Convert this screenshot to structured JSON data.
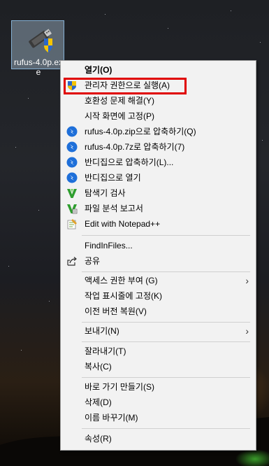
{
  "desktop": {
    "file_icon_label": "rufus-4.0p.ex\ne",
    "icon": "usb-drive-with-uac-shield-icon"
  },
  "context_menu": {
    "items": [
      {
        "label": "열기(O)",
        "bold": true,
        "icon": ""
      },
      {
        "label": "관리자 권한으로 실행(A)",
        "icon": "uac-shield-icon"
      },
      {
        "label": "호환성 문제 해결(Y)",
        "icon": ""
      },
      {
        "label": "시작 화면에 고정(P)",
        "icon": ""
      },
      {
        "label": "rufus-4.0p.zip으로 압축하기(Q)",
        "icon": "bandizip-icon"
      },
      {
        "label": "rufus-4.0p.7z로 압축하기(7)",
        "icon": "bandizip-icon"
      },
      {
        "label": "반디집으로 압축하기(L)...",
        "icon": "bandizip-icon"
      },
      {
        "label": "반디집으로 열기",
        "icon": "bandizip-icon"
      },
      {
        "label": "탐색기 검사",
        "icon": "v3-icon"
      },
      {
        "label": "파일 분석 보고서",
        "icon": "v3-report-icon"
      },
      {
        "label": "Edit with Notepad++",
        "icon": "notepad-plus-plus-icon"
      },
      {
        "label": "FindInFiles...",
        "icon": ""
      },
      {
        "label": "공유",
        "icon": "share-icon"
      },
      {
        "label": "액세스 권한 부여 (G)",
        "icon": "",
        "submenu": true
      },
      {
        "label": "작업 표시줄에 고정(K)",
        "icon": ""
      },
      {
        "label": "이전 버전 복원(V)",
        "icon": ""
      },
      {
        "label": "보내기(N)",
        "icon": "",
        "submenu": true
      },
      {
        "label": "잘라내기(T)",
        "icon": ""
      },
      {
        "label": "복사(C)",
        "icon": ""
      },
      {
        "label": "바로 가기 만들기(S)",
        "icon": ""
      },
      {
        "label": "삭제(D)",
        "icon": ""
      },
      {
        "label": "이름 바꾸기(M)",
        "icon": ""
      },
      {
        "label": "속성(R)",
        "icon": ""
      }
    ],
    "submenu_glyph": "›"
  },
  "colors": {
    "menu_bg": "#f2f2f2",
    "highlight_box": "#e00000",
    "bandizip_blue": "#1e6fd9",
    "v3_green": "#2e9e2e"
  }
}
